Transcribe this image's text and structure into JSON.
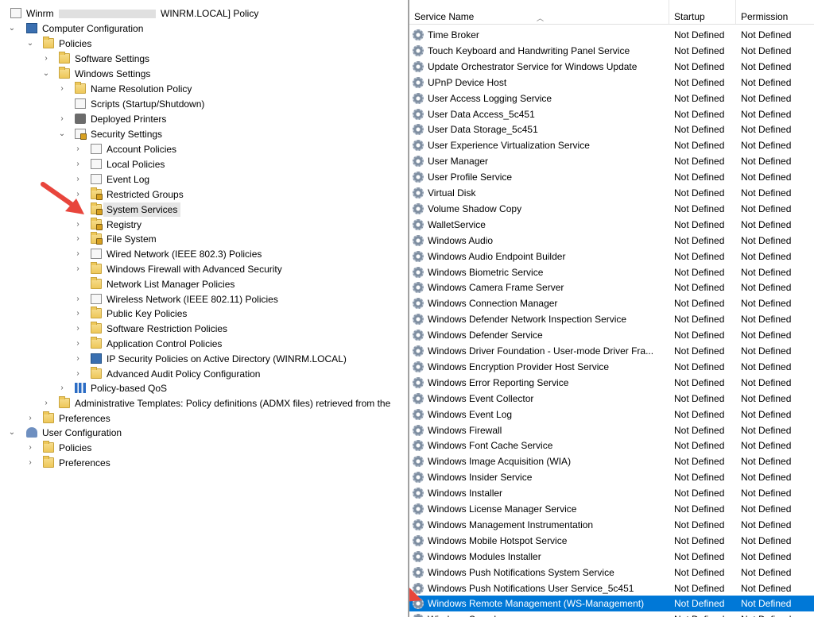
{
  "tree": {
    "root_label_prefix": "Winrm",
    "root_label_suffix": "WINRM.LOCAL] Policy",
    "computer_config": "Computer Configuration",
    "policies": "Policies",
    "software_settings": "Software Settings",
    "windows_settings": "Windows Settings",
    "name_resolution_policy": "Name Resolution Policy",
    "scripts": "Scripts (Startup/Shutdown)",
    "deployed_printers": "Deployed Printers",
    "security_settings": "Security Settings",
    "account_policies": "Account Policies",
    "local_policies": "Local Policies",
    "event_log": "Event Log",
    "restricted_groups": "Restricted Groups",
    "system_services": "System Services",
    "registry": "Registry",
    "file_system": "File System",
    "wired_network": "Wired Network (IEEE 802.3) Policies",
    "windows_firewall": "Windows Firewall with Advanced Security",
    "network_list": "Network List Manager Policies",
    "wireless_network": "Wireless Network (IEEE 802.11) Policies",
    "public_key": "Public Key Policies",
    "software_restriction": "Software Restriction Policies",
    "app_control": "Application Control Policies",
    "ip_security": "IP Security Policies on Active Directory (WINRM.LOCAL)",
    "advanced_audit": "Advanced Audit Policy Configuration",
    "policy_qos": "Policy-based QoS",
    "admin_templates": "Administrative Templates: Policy definitions (ADMX files) retrieved from the",
    "preferences": "Preferences",
    "user_config": "User Configuration",
    "user_policies": "Policies",
    "user_preferences": "Preferences"
  },
  "table": {
    "headers": {
      "name": "Service Name",
      "startup": "Startup",
      "permission": "Permission"
    },
    "selected_index": 36,
    "rows": [
      {
        "name": "Time Broker",
        "startup": "Not Defined",
        "permission": "Not Defined"
      },
      {
        "name": "Touch Keyboard and Handwriting Panel Service",
        "startup": "Not Defined",
        "permission": "Not Defined"
      },
      {
        "name": "Update Orchestrator Service for Windows Update",
        "startup": "Not Defined",
        "permission": "Not Defined"
      },
      {
        "name": "UPnP Device Host",
        "startup": "Not Defined",
        "permission": "Not Defined"
      },
      {
        "name": "User Access Logging Service",
        "startup": "Not Defined",
        "permission": "Not Defined"
      },
      {
        "name": "User Data Access_5c451",
        "startup": "Not Defined",
        "permission": "Not Defined"
      },
      {
        "name": "User Data Storage_5c451",
        "startup": "Not Defined",
        "permission": "Not Defined"
      },
      {
        "name": "User Experience Virtualization Service",
        "startup": "Not Defined",
        "permission": "Not Defined"
      },
      {
        "name": "User Manager",
        "startup": "Not Defined",
        "permission": "Not Defined"
      },
      {
        "name": "User Profile Service",
        "startup": "Not Defined",
        "permission": "Not Defined"
      },
      {
        "name": "Virtual Disk",
        "startup": "Not Defined",
        "permission": "Not Defined"
      },
      {
        "name": "Volume Shadow Copy",
        "startup": "Not Defined",
        "permission": "Not Defined"
      },
      {
        "name": "WalletService",
        "startup": "Not Defined",
        "permission": "Not Defined"
      },
      {
        "name": "Windows Audio",
        "startup": "Not Defined",
        "permission": "Not Defined"
      },
      {
        "name": "Windows Audio Endpoint Builder",
        "startup": "Not Defined",
        "permission": "Not Defined"
      },
      {
        "name": "Windows Biometric Service",
        "startup": "Not Defined",
        "permission": "Not Defined"
      },
      {
        "name": "Windows Camera Frame Server",
        "startup": "Not Defined",
        "permission": "Not Defined"
      },
      {
        "name": "Windows Connection Manager",
        "startup": "Not Defined",
        "permission": "Not Defined"
      },
      {
        "name": "Windows Defender Network Inspection Service",
        "startup": "Not Defined",
        "permission": "Not Defined"
      },
      {
        "name": "Windows Defender Service",
        "startup": "Not Defined",
        "permission": "Not Defined"
      },
      {
        "name": "Windows Driver Foundation - User-mode Driver Fra...",
        "startup": "Not Defined",
        "permission": "Not Defined"
      },
      {
        "name": "Windows Encryption Provider Host Service",
        "startup": "Not Defined",
        "permission": "Not Defined"
      },
      {
        "name": "Windows Error Reporting Service",
        "startup": "Not Defined",
        "permission": "Not Defined"
      },
      {
        "name": "Windows Event Collector",
        "startup": "Not Defined",
        "permission": "Not Defined"
      },
      {
        "name": "Windows Event Log",
        "startup": "Not Defined",
        "permission": "Not Defined"
      },
      {
        "name": "Windows Firewall",
        "startup": "Not Defined",
        "permission": "Not Defined"
      },
      {
        "name": "Windows Font Cache Service",
        "startup": "Not Defined",
        "permission": "Not Defined"
      },
      {
        "name": "Windows Image Acquisition (WIA)",
        "startup": "Not Defined",
        "permission": "Not Defined"
      },
      {
        "name": "Windows Insider Service",
        "startup": "Not Defined",
        "permission": "Not Defined"
      },
      {
        "name": "Windows Installer",
        "startup": "Not Defined",
        "permission": "Not Defined"
      },
      {
        "name": "Windows License Manager Service",
        "startup": "Not Defined",
        "permission": "Not Defined"
      },
      {
        "name": "Windows Management Instrumentation",
        "startup": "Not Defined",
        "permission": "Not Defined"
      },
      {
        "name": "Windows Mobile Hotspot Service",
        "startup": "Not Defined",
        "permission": "Not Defined"
      },
      {
        "name": "Windows Modules Installer",
        "startup": "Not Defined",
        "permission": "Not Defined"
      },
      {
        "name": "Windows Push Notifications System Service",
        "startup": "Not Defined",
        "permission": "Not Defined"
      },
      {
        "name": "Windows Push Notifications User Service_5c451",
        "startup": "Not Defined",
        "permission": "Not Defined"
      },
      {
        "name": "Windows Remote Management (WS-Management)",
        "startup": "Not Defined",
        "permission": "Not Defined"
      },
      {
        "name": "Windows Search",
        "startup": "Not Defined",
        "permission": "Not Defined"
      }
    ]
  },
  "colors": {
    "selection": "#0078d7",
    "arrow": "#e8453c",
    "folder": "#eec85a"
  }
}
